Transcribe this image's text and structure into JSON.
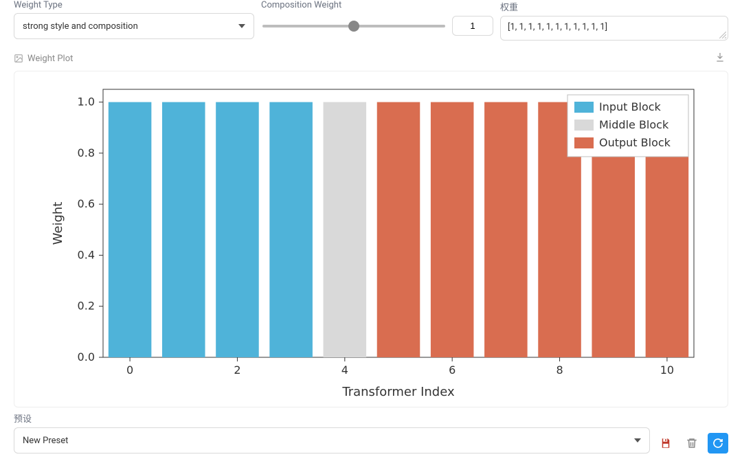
{
  "controls": {
    "weight_type_label": "Weight Type",
    "weight_type_value": "strong style and composition",
    "comp_weight_label": "Composition Weight",
    "comp_weight_value": "1",
    "weights_label": "权重",
    "weights_value": "[1, 1, 1, 1, 1, 1, 1, 1, 1, 1, 1]",
    "plot_title": "Weight Plot",
    "preset_label": "预设",
    "preset_value": "New Preset"
  },
  "chart_data": {
    "type": "bar",
    "xlabel": "Transformer Index",
    "ylabel": "Weight",
    "xlim": [
      -0.5,
      10.5
    ],
    "ylim": [
      0.0,
      1.05
    ],
    "xticks": [
      0,
      2,
      4,
      6,
      8,
      10
    ],
    "yticks": [
      0.0,
      0.2,
      0.4,
      0.6,
      0.8,
      1.0
    ],
    "categories": [
      0,
      1,
      2,
      3,
      4,
      5,
      6,
      7,
      8,
      9,
      10
    ],
    "series": [
      {
        "name": "Input Block",
        "color": "#4fb3d9",
        "mask": [
          1,
          1,
          1,
          1,
          0,
          0,
          0,
          0,
          0,
          0,
          0
        ]
      },
      {
        "name": "Middle Block",
        "color": "#d9d9d9",
        "mask": [
          0,
          0,
          0,
          0,
          1,
          0,
          0,
          0,
          0,
          0,
          0
        ]
      },
      {
        "name": "Output Block",
        "color": "#d96d50",
        "mask": [
          0,
          0,
          0,
          0,
          0,
          1,
          1,
          1,
          1,
          1,
          1
        ]
      }
    ],
    "values": [
      1,
      1,
      1,
      1,
      1,
      1,
      1,
      1,
      1,
      1,
      1
    ],
    "legend_position": "upper right"
  }
}
